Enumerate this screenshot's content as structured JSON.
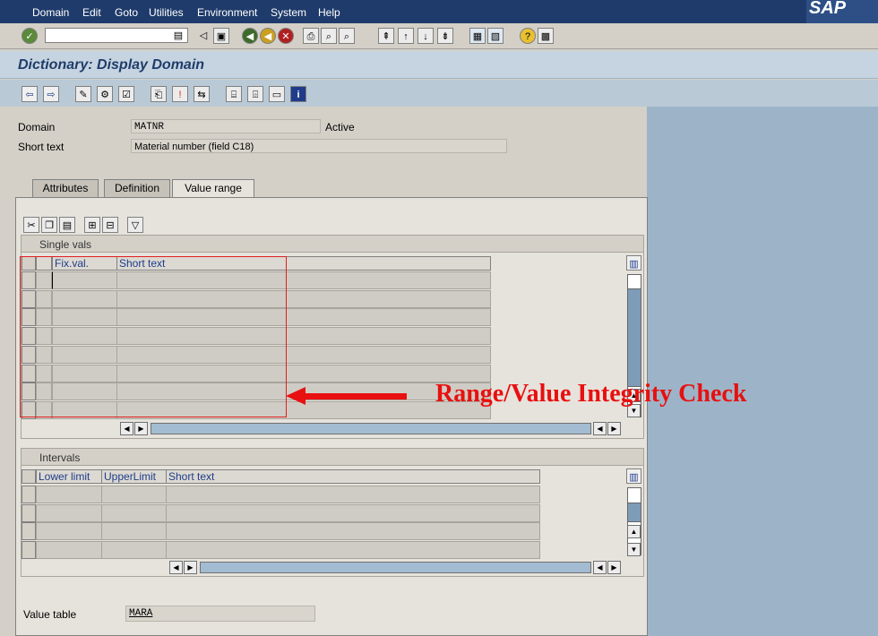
{
  "menu": {
    "items": [
      "Domain",
      "Edit",
      "Goto",
      "Utilities",
      "Environment",
      "System",
      "Help"
    ]
  },
  "logo": "SAP",
  "title": "Dictionary: Display Domain",
  "header": {
    "domain_label": "Domain",
    "domain_value": "MATNR",
    "status": "Active",
    "short_text_label": "Short text",
    "short_text_value": "Material number (field C18)"
  },
  "tabs": [
    {
      "label": "Attributes",
      "active": false
    },
    {
      "label": "Definition",
      "active": false
    },
    {
      "label": "Value range",
      "active": true
    }
  ],
  "single_vals": {
    "title": "Single vals",
    "columns": [
      "Fix.val.",
      "Short text"
    ],
    "row_count": 8
  },
  "intervals": {
    "title": "Intervals",
    "columns": [
      "Lower limit",
      "UpperLimit",
      "Short text"
    ],
    "row_count": 4
  },
  "value_table": {
    "label": "Value table",
    "value": "MARA"
  },
  "annotation": {
    "text": "Range/Value Integrity Check",
    "color": "#e81010"
  },
  "colors": {
    "menubar": "#1f3b6b",
    "title": "#1f3c6a",
    "panel": "#e6e3dc",
    "blue_area": "#9db4c8"
  }
}
